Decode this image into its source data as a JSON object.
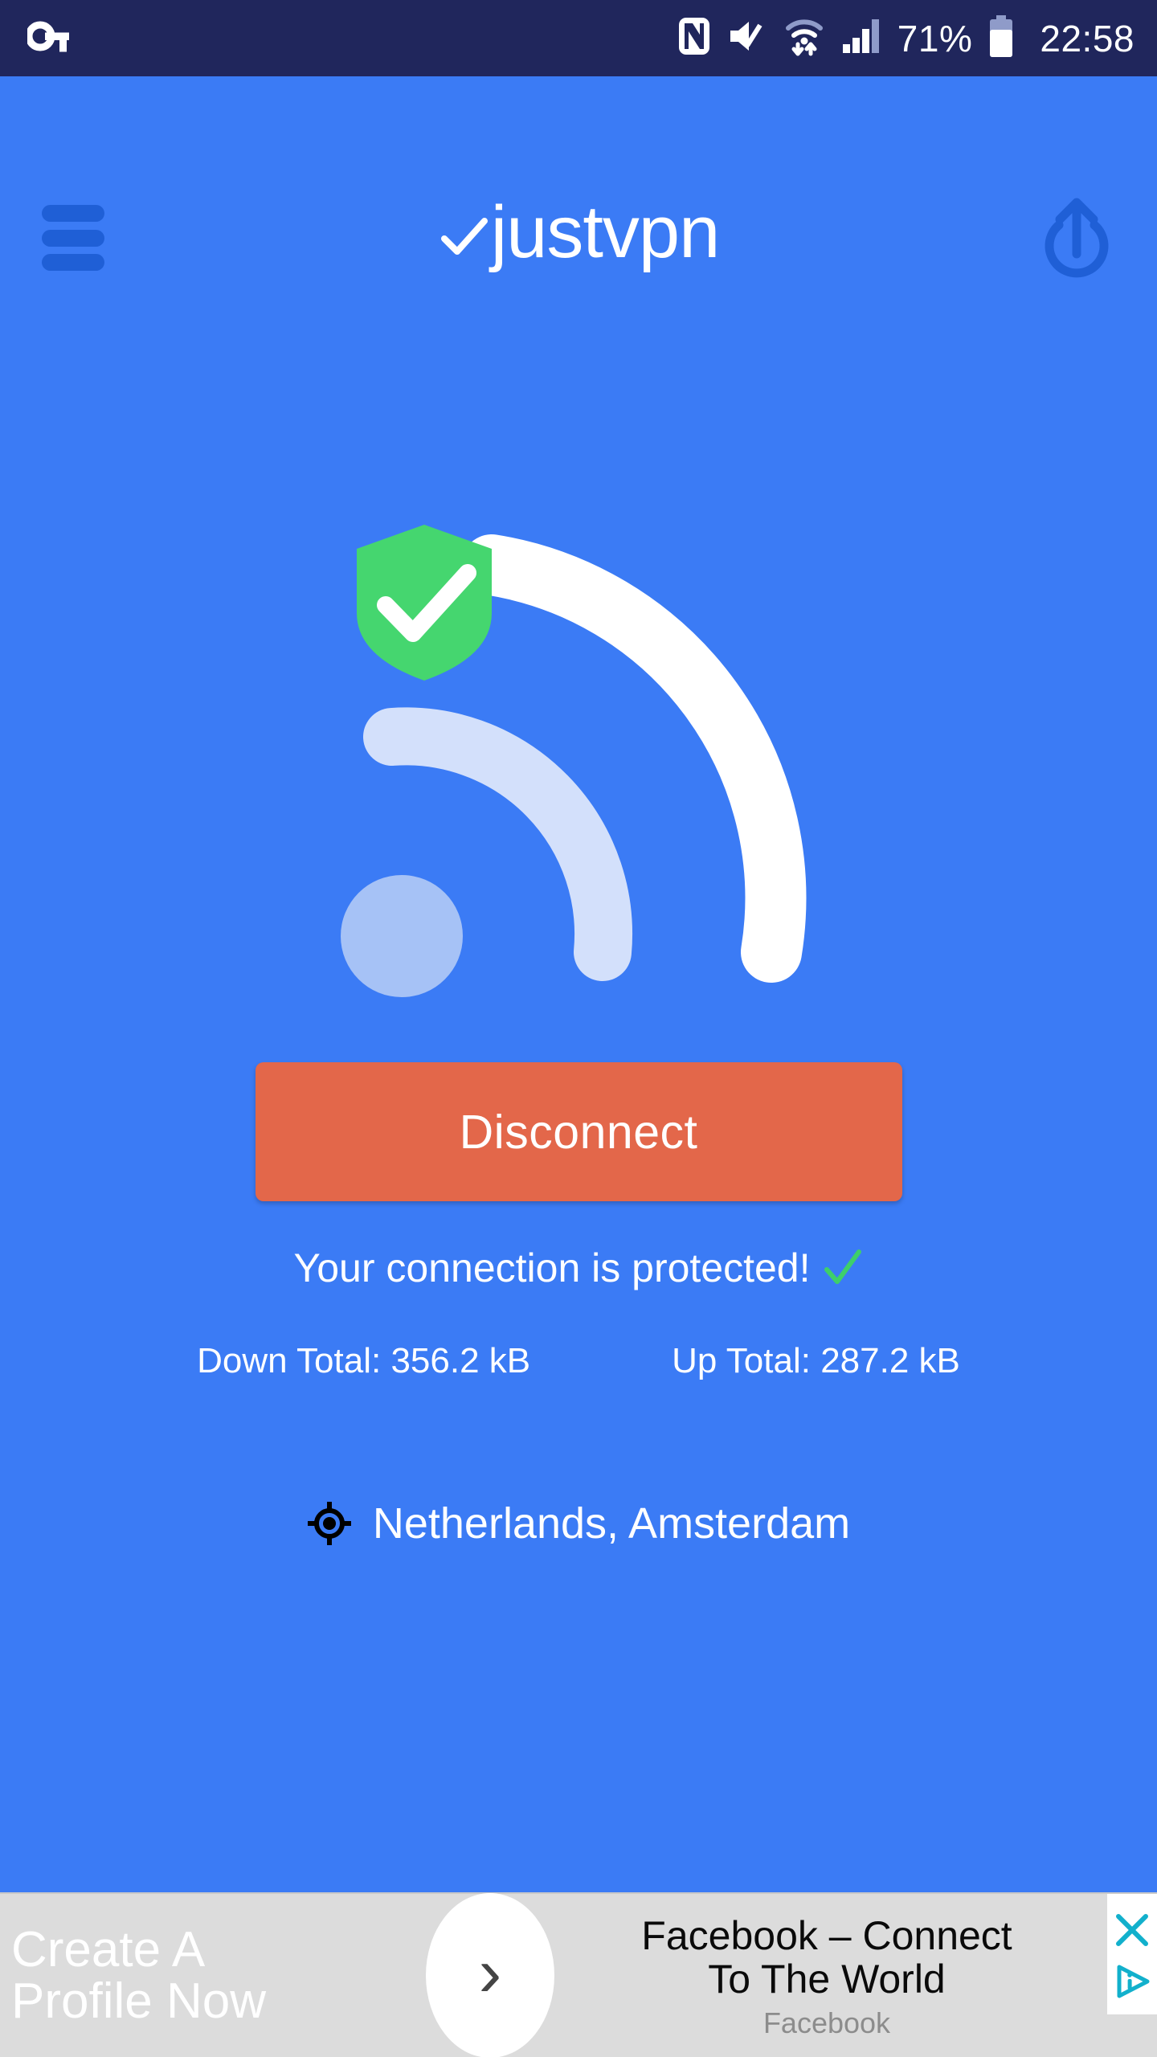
{
  "status_bar": {
    "vpn_key_icon": "vpn-key-icon",
    "nfc_icon": "nfc-icon",
    "mute_icon": "volume-mute-icon",
    "wifi_icon": "wifi-transfer-icon",
    "signal_icon": "cellular-signal-icon",
    "battery_percent": "71%",
    "battery_icon": "battery-icon",
    "time": "22:58",
    "background_color": "#20265c",
    "text_color": "#ffffff"
  },
  "header": {
    "menu_icon": "hamburger-menu-icon",
    "brand": "justvpn",
    "brand_check_icon": "check-icon",
    "upgrade_icon": "power-upgrade-icon",
    "icon_color": "#1f5fd6",
    "brand_color": "#ffffff"
  },
  "hero": {
    "icon": "protected-wifi-signal-icon",
    "shield_icon": "green-shield-check-icon",
    "shield_color": "#45d66f",
    "arc_outer_color": "#ffffff",
    "arc_middle_color": "#d3e0fb",
    "dot_color": "#a6c2f6"
  },
  "main": {
    "disconnect_label": "Disconnect",
    "disconnect_color": "#e3674a",
    "status_text": "Your connection is protected!",
    "status_check_icon": "green-check-icon",
    "status_check_color": "#3ecf6a",
    "down_total": "Down Total: 356.2 kB",
    "up_total": "Up Total: 287.2 kB",
    "location_icon": "gps-crosshair-icon",
    "location": "Netherlands, Amsterdam",
    "background_color": "#3b7bf5"
  },
  "ad": {
    "left_line_1": "Create A",
    "left_line_2": "Profile Now",
    "arrow_icon": "chevron-right-icon",
    "arrow_glyph": "›",
    "title_line_1": "Facebook – Connect",
    "title_line_2": "To The World",
    "advertiser": "Facebook",
    "close_icon": "close-x-icon",
    "adchoices_icon": "adchoices-icon",
    "accent_color": "#12b0cc",
    "background_color": "#dcdcdc"
  }
}
